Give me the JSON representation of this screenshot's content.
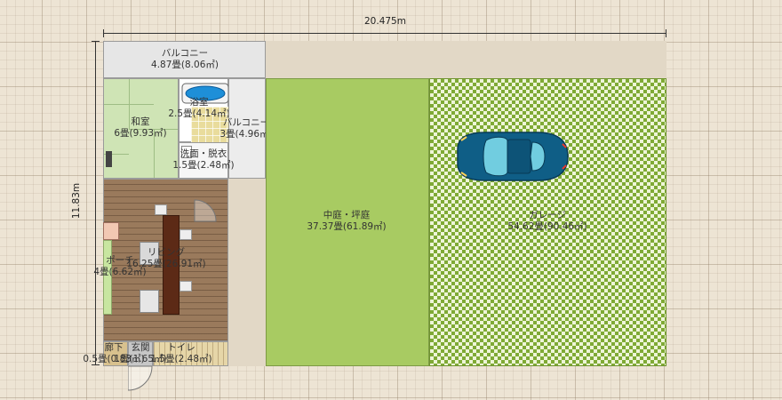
{
  "dimensions": {
    "width_label": "20.475m",
    "height_label": "11.83m"
  },
  "rooms": {
    "balcony_top": {
      "name": "バルコニー",
      "area": "4.87畳(8.06㎡)"
    },
    "washitsu": {
      "name": "和室",
      "area": "6畳(9.93㎡)"
    },
    "bath": {
      "name": "浴室",
      "area": "2.5畳(4.14㎡)"
    },
    "balcony_right": {
      "name": "バルコニー",
      "area": "3畳(4.96㎡)"
    },
    "senmen": {
      "name": "洗面・脱衣",
      "area": "1.5畳(2.48㎡)"
    },
    "living": {
      "name": "リビング",
      "area": "16.25畳(26.91㎡)"
    },
    "porch": {
      "name": "ポーチ",
      "area": "4畳(6.62㎡)"
    },
    "nakaniwa": {
      "name": "中庭・坪庭",
      "area": "37.37畳(61.89㎡)"
    },
    "garage": {
      "name": "ガレージ",
      "area": "54.62畳(90.46㎡)"
    },
    "rouka": {
      "name": "廊下",
      "area": "0.5畳(0.83㎡)"
    },
    "genkan": {
      "name": "玄関",
      "area": "1畳(1.65㎡)"
    },
    "toilet": {
      "name": "トイレ",
      "area": "1.5畳(2.48㎡)"
    }
  },
  "icons": [
    "car-icon",
    "bathtub-icon",
    "dining-table-icon",
    "sofa-icon",
    "door-swing-icon",
    "shelf-icon"
  ],
  "colors": {
    "grid_bg": "#ede4d4",
    "wood_floor": "#9a7a5c",
    "tatami": "#cfe4b5",
    "tile": "#e9dc9c",
    "courtyard": "#a8cb62",
    "garage_a": "#7faa35",
    "garage_b": "#eef5d8",
    "balcony": "#e6e6e6",
    "car_body": "#0f5e86",
    "car_glass": "#71cde0"
  }
}
